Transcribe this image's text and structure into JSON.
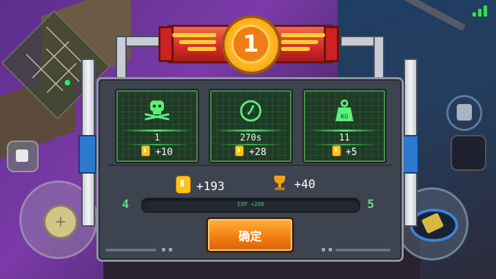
{
  "level_badge": "1",
  "stats": [
    {
      "icon": "skull-icon",
      "value": "1",
      "reward": "+10"
    },
    {
      "icon": "clock-icon",
      "value": "270s",
      "reward": "+28"
    },
    {
      "icon": "weight-icon",
      "icon_text": "KG",
      "value": "11",
      "reward": "+5"
    }
  ],
  "totals": {
    "coins": "+193",
    "trophies": "+40"
  },
  "level": {
    "current": "4",
    "next": "5",
    "exp_text": "EXP +200",
    "progress": 0.0
  },
  "confirm_label": "确定",
  "colors": {
    "accent_green": "#4ef06c",
    "coin": "#ffc21a",
    "button": "#f27a0e",
    "banner": "#d42a2a"
  }
}
